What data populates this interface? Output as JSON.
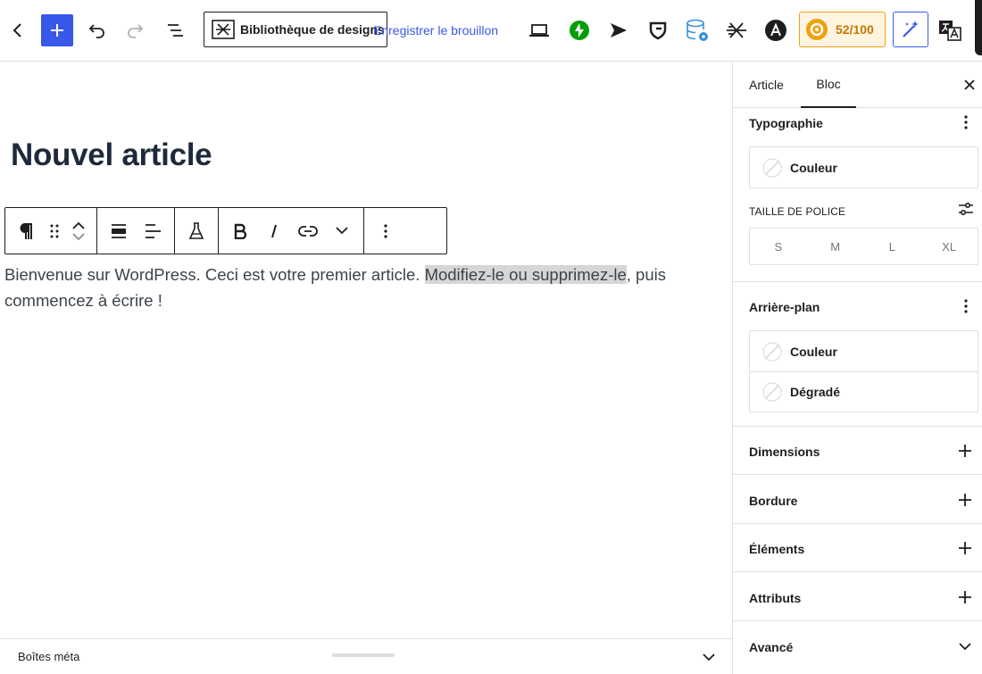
{
  "topbar": {
    "design_library_label": "Bibliothèque de designs",
    "save_draft_label": "Enregistrer le brouillon",
    "score_label": "52/100",
    "colors": {
      "accent": "#3858e9",
      "jetpack_green": "#069e08",
      "score_orange": "#f0a20c"
    }
  },
  "editor": {
    "post_title": "Nouvel article",
    "paragraph_before": "Bienvenue sur WordPress. Ceci est votre premier article. ",
    "paragraph_selected": "Modifiez-le ou supprimez-le",
    "paragraph_after": ", puis commencez à écrire !"
  },
  "metabar": {
    "label": "Boîtes méta"
  },
  "sidebar": {
    "tabs": [
      {
        "label": "Article"
      },
      {
        "label": "Bloc",
        "active": true
      }
    ],
    "typography": {
      "title": "Typographie",
      "color_label": "Couleur",
      "font_size_label": "TAILLE DE POLICE",
      "font_sizes": [
        "S",
        "M",
        "L",
        "XL"
      ]
    },
    "background": {
      "title": "Arrière-plan",
      "color_label": "Couleur",
      "gradient_label": "Dégradé"
    },
    "sections": [
      {
        "title": "Dimensions",
        "icon": "plus-icon"
      },
      {
        "title": "Bordure",
        "icon": "plus-icon"
      },
      {
        "title": "Éléments",
        "icon": "plus-icon"
      },
      {
        "title": "Attributs",
        "icon": "plus-icon"
      },
      {
        "title": "Avancé",
        "icon": "chevron-down-icon"
      }
    ]
  }
}
